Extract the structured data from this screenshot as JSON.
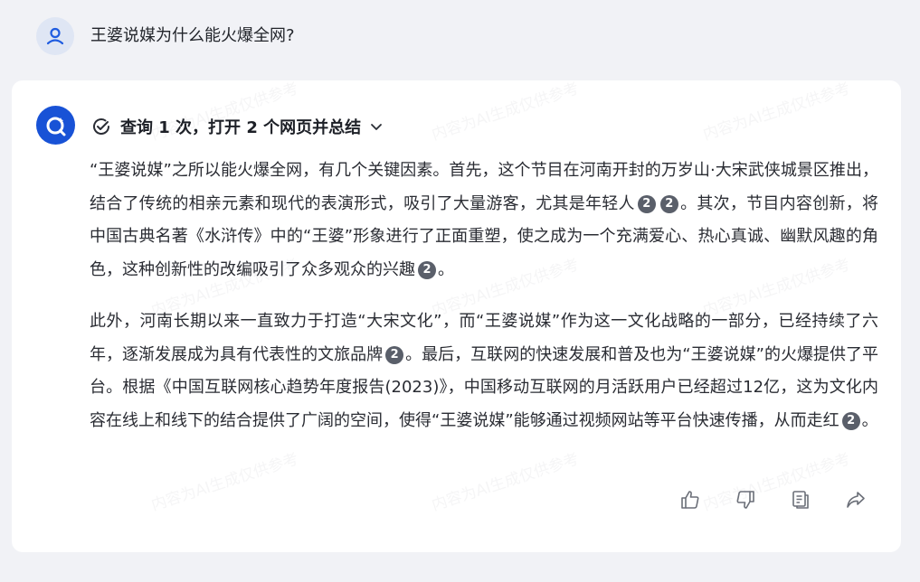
{
  "conversation": {
    "question": "王婆说媒为什么能火爆全网?",
    "search_summary": "查询 1 次，打开 2 个网页并总结",
    "answer": {
      "paragraph1": {
        "s1": "“王婆说媒”之所以能火爆全网，有几个关键因素。首先，这个节目在河南开封的万岁山·大宋武侠城景区推出，结合了传统的相亲元素和现代的表演形式，吸引了大量游客，尤其是年轻人",
        "c1": "2",
        "c2": "2",
        "s2": "。其次，节目内容创新，将中国古典名著《水浒传》中的“王婆”形象进行了正面重塑，使之成为一个充满爱心、热心真诚、幽默风趣的角色，这种创新性的改编吸引了众多观众的兴趣",
        "c3": "2",
        "s3": "。"
      },
      "paragraph2": {
        "s1": "此外，河南长期以来一直致力于打造“大宋文化”，而“王婆说媒”作为这一文化战略的一部分，已经持续了六年，逐渐发展成为具有代表性的文旅品牌",
        "c1": "2",
        "s2": "。最后，互联网的快速发展和普及也为“王婆说媒”的火爆提供了平台。根据《中国互联网核心趋势年度报告(2023)》，中国移动互联网的月活跃用户已经超过12亿，这为文化内容在线上和线下的结合提供了广阔的空间，使得“王婆说媒”能够通过视频网站等平台快速传播，从而走红",
        "c2": "2",
        "s3": "。"
      }
    }
  },
  "icons": {
    "user_avatar": "user-avatar-icon",
    "bot_avatar": "bot-avatar-icon",
    "search_check": "check-circle-icon",
    "expand": "chevron-down-icon",
    "like": "thumbs-up-icon",
    "dislike": "thumbs-down-icon",
    "copy": "copy-icon",
    "share": "share-icon"
  },
  "colors": {
    "background": "#f1f2f6",
    "card": "#ffffff",
    "brand_blue": "#1852d6",
    "avatar_bg": "#dfe6f4",
    "citation_badge": "#5a5f6a"
  }
}
